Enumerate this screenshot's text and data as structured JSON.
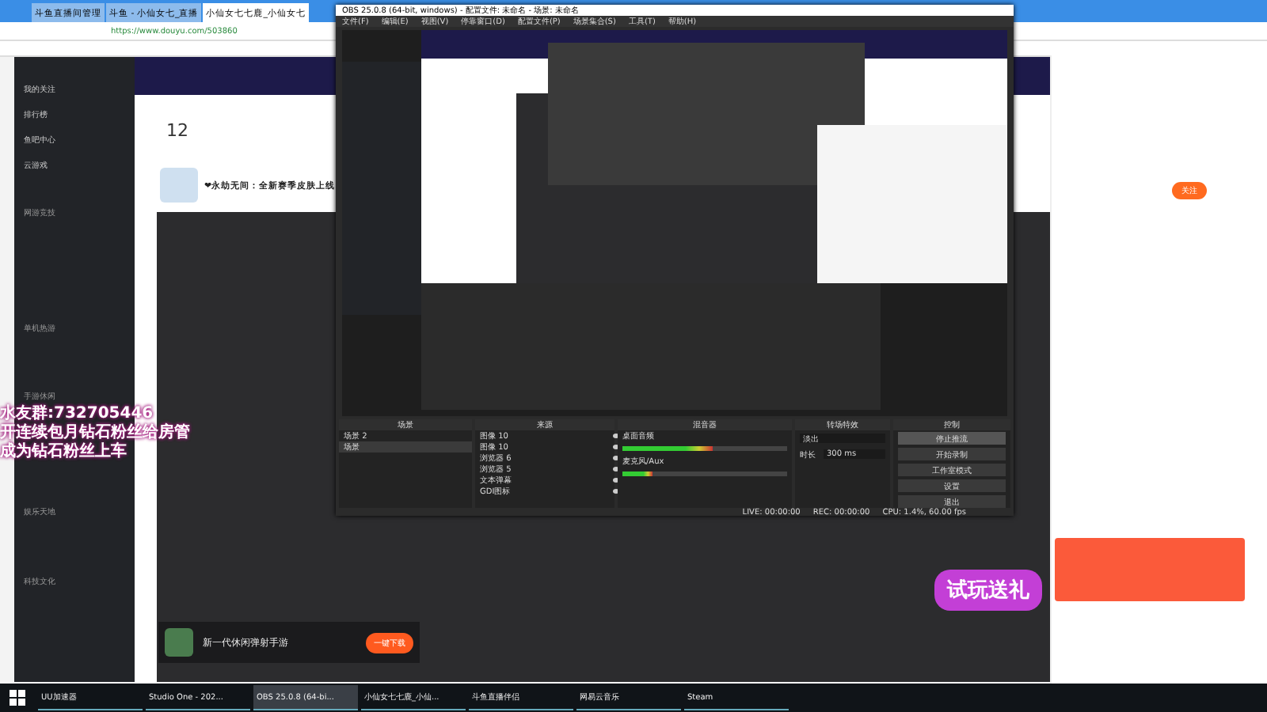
{
  "browser": {
    "tabs": [
      {
        "label": "斗鱼直播间管理",
        "selected": false
      },
      {
        "label": "斗鱼 - 小仙女七_直播",
        "selected": false
      },
      {
        "label": "小仙女七七鹿_小仙女七",
        "selected": true
      }
    ],
    "url": "https://www.douyu.com/503860"
  },
  "sidebar": {
    "items": [
      {
        "label": "我的关注"
      },
      {
        "label": "排行榜"
      },
      {
        "label": "鱼吧中心"
      },
      {
        "label": "云游戏"
      }
    ],
    "sections": [
      "网游竞技",
      "单机热游",
      "手游休闲",
      "娱乐天地",
      "科技文化"
    ]
  },
  "room": {
    "score": "12",
    "title": "❤永劫无间：全新赛季皮肤上线",
    "follow": "关注"
  },
  "overlay": [
    "水友群:732705446",
    "开连续包月钻石粉丝给房管",
    "成为钻石粉丝上车"
  ],
  "ad": {
    "title": "新一代休闲弹射手游",
    "button": "一键下载"
  },
  "obs": {
    "title": "OBS 25.0.8 (64-bit, windows) - 配置文件: 未命名 - 场景: 未命名",
    "menu": [
      "文件(F)",
      "编辑(E)",
      "视图(V)",
      "停靠窗口(D)",
      "配置文件(P)",
      "场景集合(S)",
      "工具(T)",
      "帮助(H)"
    ],
    "docks": [
      "场景",
      "来源",
      "混音器",
      "转场特效",
      "控制"
    ],
    "scenes": [
      {
        "label": "场景 2",
        "selected": false
      },
      {
        "label": "场景",
        "selected": true
      }
    ],
    "sources": [
      {
        "label": "图像 10",
        "visible": true
      },
      {
        "label": "图像 10",
        "visible": true
      },
      {
        "label": "浏览器 6",
        "visible": true
      },
      {
        "label": "浏览器 5",
        "visible": true
      },
      {
        "label": "文本弹幕",
        "visible": true
      },
      {
        "label": "GDI图标",
        "visible": true
      }
    ],
    "mixer": [
      {
        "name": "桌面音频",
        "level": 0.55
      },
      {
        "name": "麦克风/Aux",
        "level": 0.18
      }
    ],
    "transition": {
      "type": "淡出",
      "duration": "300 ms",
      "duration_label": "时长"
    },
    "controls": [
      {
        "label": "停止推流",
        "selected": true
      },
      {
        "label": "开始录制",
        "selected": false
      },
      {
        "label": "工作室模式",
        "selected": false
      },
      {
        "label": "设置",
        "selected": false
      },
      {
        "label": "退出",
        "selected": false
      }
    ],
    "status": [
      "LIVE: 00:00:00",
      "REC: 00:00:00",
      "CPU: 1.4%, 60.00 fps"
    ]
  },
  "gift": {
    "title": "试玩送礼"
  },
  "taskbar": {
    "apps": [
      {
        "label": "UU加速器",
        "selected": false
      },
      {
        "label": "Studio One - 202...",
        "selected": false
      },
      {
        "label": "OBS 25.0.8 (64-bi...",
        "selected": true
      },
      {
        "label": "小仙女七七鹿_小仙...",
        "selected": false
      },
      {
        "label": "斗鱼直播伴侣",
        "selected": false
      },
      {
        "label": "网易云音乐",
        "selected": false
      },
      {
        "label": "Steam",
        "selected": false
      }
    ]
  }
}
